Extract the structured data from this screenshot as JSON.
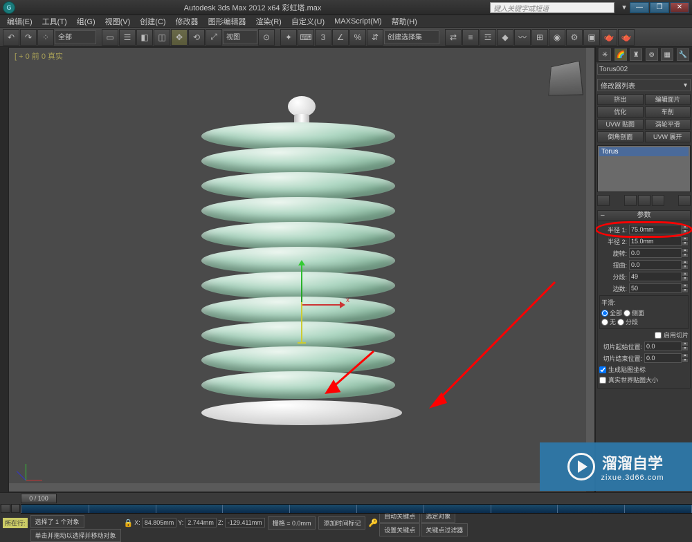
{
  "title": "Autodesk 3ds Max 2012 x64 彩虹塔.max",
  "search_placeholder": "键入关键字或短语",
  "menu": [
    "编辑(E)",
    "工具(T)",
    "组(G)",
    "视图(V)",
    "创建(C)",
    "修改器",
    "图形编辑器",
    "渲染(R)",
    "自定义(U)",
    "MAXScript(M)",
    "帮助(H)"
  ],
  "toolbar": {
    "selset": "全部",
    "view": "视图",
    "createset": "创建选择集"
  },
  "viewport": {
    "label": "[ + 0 前 0 真实"
  },
  "cmd": {
    "object_name": "Torus002",
    "modlist": "修改器列表",
    "buttons": [
      "挤出",
      "编辑面片",
      "优化",
      "车削",
      "UVW 贴图",
      "涡轮平滑",
      "倒角剖面",
      "UVW 展开"
    ],
    "stack_item": "Torus",
    "rollout_title": "参数",
    "params": {
      "r1_label": "半径 1:",
      "r1": "75.0mm",
      "r2_label": "半径 2:",
      "r2": "15.0mm",
      "rot_label": "旋转:",
      "rot": "0.0",
      "twist_label": "扭曲:",
      "twist": "0.0",
      "segs_label": "分段:",
      "segs": "49",
      "sides_label": "边数:",
      "sides": "50"
    },
    "smooth": {
      "title": "平滑:",
      "all": "全部",
      "sides": "侧面",
      "none": "无",
      "segs": "分段"
    },
    "slice": {
      "enable": "启用切片",
      "start_label": "切片起始位置:",
      "start": "0.0",
      "end_label": "切片结束位置:",
      "end": "0.0"
    },
    "gen_uv": "生成贴图坐标",
    "real_uv": "真实世界贴图大小"
  },
  "timeline": {
    "frame": "0 / 100"
  },
  "status": {
    "sel": "选择了 1 个对象",
    "hint": "单击并拖动以选择并移动对象",
    "x": "84.805mm",
    "y": "2.744mm",
    "z": "-129.411mm",
    "grid": "栅格 = 0.0mm",
    "autokey": "自动关键点",
    "selset2": "选定对象",
    "setkey": "设置关键点",
    "keyfilter": "关键点过滤器",
    "addmark": "添加时间标记",
    "row": "所在行:"
  },
  "watermark": {
    "big": "溜溜自学",
    "small": "zixue.3d66.com"
  }
}
